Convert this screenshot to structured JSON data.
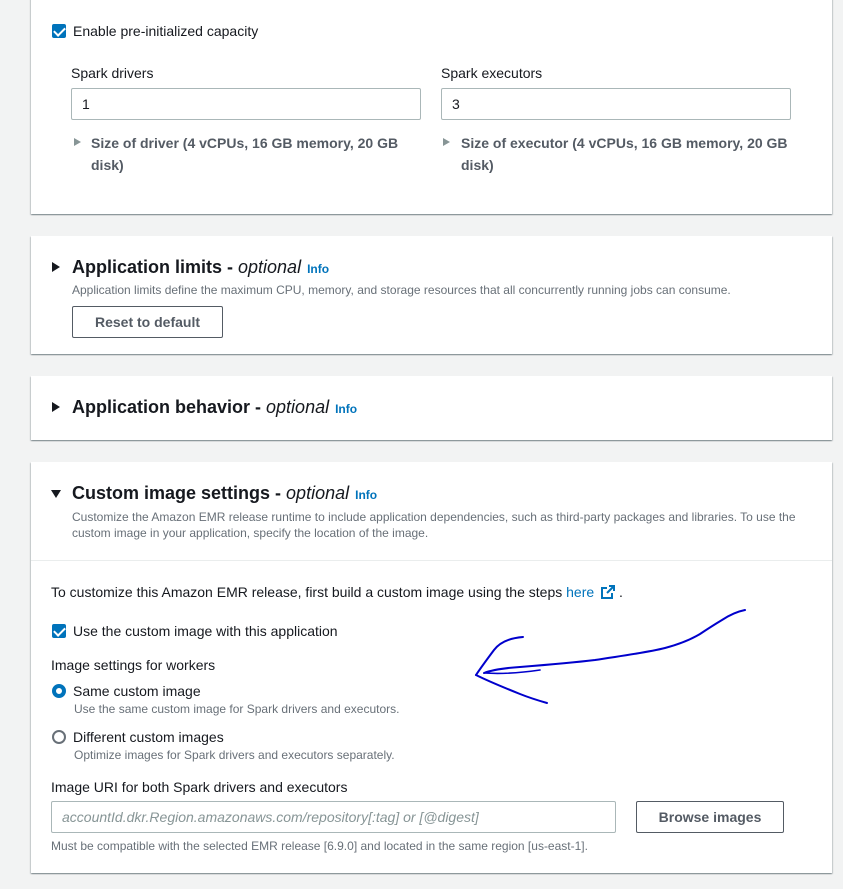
{
  "capacity": {
    "enable_label": "Enable pre-initialized capacity",
    "drivers_label": "Spark drivers",
    "drivers_value": "1",
    "executors_label": "Spark executors",
    "executors_value": "3",
    "driver_size_line1": "Size of driver (4 vCPUs, 16 GB memory, 20 GB",
    "driver_size_line2": "disk)",
    "executor_size_line1": "Size of executor (4 vCPUs, 16 GB memory, 20 GB",
    "executor_size_line2": "disk)"
  },
  "limits": {
    "title": "Application limits",
    "optional": "optional",
    "info": "Info",
    "description": "Application limits define the maximum CPU, memory, and storage resources that all concurrently running jobs can consume.",
    "reset_label": "Reset to default"
  },
  "behavior": {
    "title": "Application behavior",
    "optional": "optional",
    "info": "Info"
  },
  "custom_image": {
    "title": "Custom image settings",
    "optional": "optional",
    "info": "Info",
    "description_line1": "Customize the Amazon EMR release runtime to include application dependencies, such as third-party packages and libraries. To use the",
    "description_line2": "custom image in your application, specify the location of the image.",
    "intro_text": "To customize this Amazon EMR release, first build a custom image using the steps",
    "here_link": "here",
    "period": ".",
    "use_custom_label": "Use the custom image with this application",
    "workers_label": "Image settings for workers",
    "same_label": "Same custom image",
    "same_desc": "Use the same custom image for Spark drivers and executors.",
    "different_label": "Different custom images",
    "different_desc": "Optimize images for Spark drivers and executors separately.",
    "uri_label": "Image URI for both Spark drivers and executors",
    "uri_placeholder": "accountId.dkr.Region.amazonaws.com/repository[:tag] or [@digest]",
    "browse_label": "Browse images",
    "constraint": "Must be compatible with the selected EMR release [6.9.0] and located in the same region [us-east-1]."
  },
  "colors": {
    "accent": "#0073bb",
    "annotation": "#0000cc"
  },
  "icons": {
    "external": "external-link-icon",
    "caret_right": "caret-right-icon",
    "caret_down": "caret-down-icon"
  }
}
